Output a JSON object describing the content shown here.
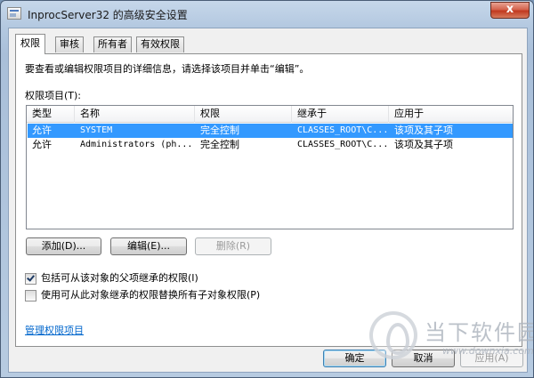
{
  "window": {
    "title": "InprocServer32 的高级安全设置",
    "close_symbol": "x"
  },
  "tabs": [
    {
      "label": "权限",
      "active": true
    },
    {
      "label": "审核",
      "active": false
    },
    {
      "label": "所有者",
      "active": false
    },
    {
      "label": "有效权限",
      "active": false
    }
  ],
  "permissions": {
    "info_text": "要查看或编辑权限项目的详细信息，请选择该项目并单击“编辑”。",
    "list_label": "权限项目(T):",
    "columns": [
      "类型",
      "名称",
      "权限",
      "继承于",
      "应用于"
    ],
    "rows": [
      {
        "type": "允许",
        "name": "SYSTEM",
        "permission": "完全控制",
        "inherited_from": "CLASSES_ROOT\\C...",
        "applies_to": "该项及其子项",
        "selected": true
      },
      {
        "type": "允许",
        "name": "Administrators (ph...",
        "permission": "完全控制",
        "inherited_from": "CLASSES_ROOT\\C...",
        "applies_to": "该项及其子项",
        "selected": false
      }
    ],
    "add_button": "添加(D)...",
    "edit_button": "编辑(E)...",
    "remove_button": "删除(R)",
    "include_inheritable_label": "包括可从该对象的父项继承的权限(I)",
    "include_inheritable_checked": true,
    "replace_child_label": "使用可从此对象继承的权限替换所有子对象权限(P)",
    "replace_child_checked": false,
    "manage_link": "管理权限项目"
  },
  "footer": {
    "ok_button": "确定",
    "cancel_button": "取消",
    "apply_button": "应用(A)"
  },
  "watermark": {
    "text": "当下软件园",
    "url": "www.downxia.com"
  }
}
